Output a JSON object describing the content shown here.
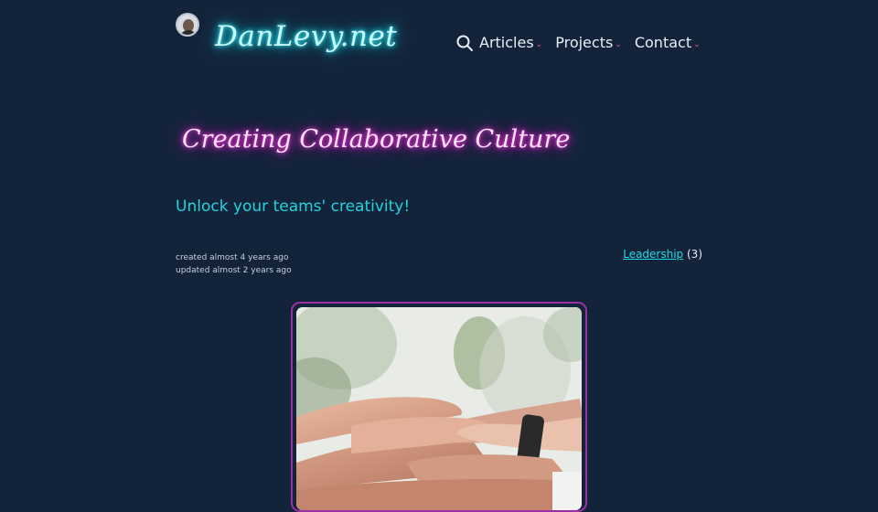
{
  "site": {
    "logo_text": "DanLevy.net"
  },
  "nav": {
    "items": [
      {
        "label": "Articles"
      },
      {
        "label": "Projects"
      },
      {
        "label": "Contact"
      }
    ]
  },
  "article": {
    "title": "Creating Collaborative Culture",
    "subtitle": "Unlock your teams' creativity!",
    "created": "created almost 4 years ago",
    "updated": "updated almost 2 years ago",
    "tag": {
      "label": "Leadership",
      "count": "(3)"
    }
  },
  "colors": {
    "background": "#13243a",
    "logo_glow": "#18d8e8",
    "title_glow": "#e020c8",
    "subtitle": "#20d4de",
    "nav_chevron": "#ff4fa8",
    "image_border": "#9a2fa6"
  },
  "icons": [
    "search-icon",
    "chevron-down-icon"
  ]
}
